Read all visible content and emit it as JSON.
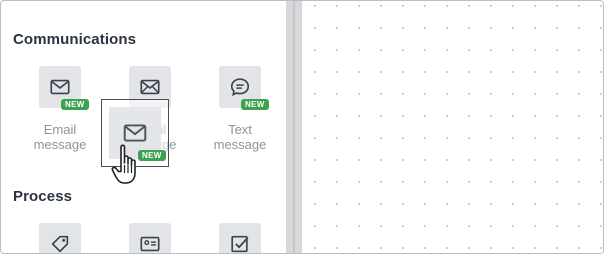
{
  "sections": {
    "communications": "Communications",
    "process": "Process"
  },
  "tiles": {
    "email": {
      "label_line1": "Email",
      "label_line2": "message",
      "badge": "NEW",
      "icon": "envelope-icon"
    },
    "email2": {
      "label_line1": "Email",
      "label_line2": "message",
      "icon": "envelope-icon"
    },
    "text": {
      "label_line1": "Text",
      "label_line2": "message",
      "badge": "NEW",
      "icon": "chat-bubble-icon"
    },
    "tag": {
      "icon": "tag-icon"
    },
    "contact": {
      "icon": "contact-card-icon"
    },
    "task": {
      "icon": "checkbox-icon"
    }
  },
  "drag_ghost": {
    "badge": "NEW",
    "icon": "envelope-icon"
  },
  "colors": {
    "badge": "#3da24e",
    "tile": "#e2e4e7",
    "title": "#2b3440",
    "label": "#8e949a"
  }
}
